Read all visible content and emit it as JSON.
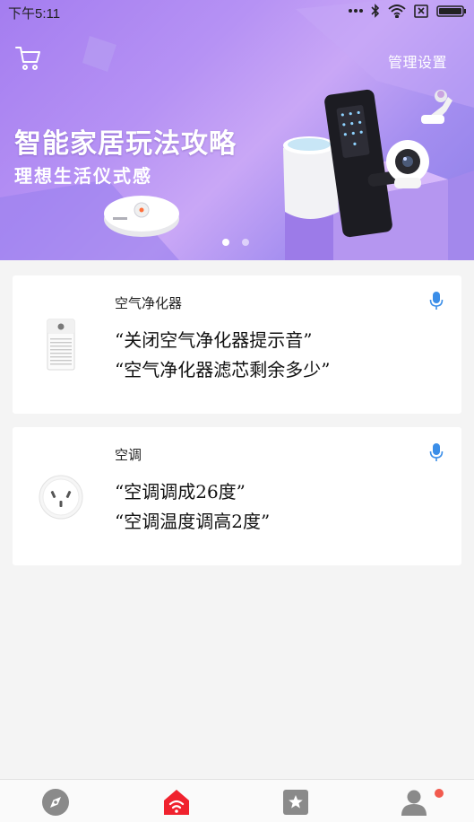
{
  "status_bar": {
    "time": "下午5:11",
    "icons": [
      "dots-icon",
      "bluetooth-icon",
      "wifi-icon",
      "no-sim-icon",
      "battery-icon"
    ]
  },
  "banner": {
    "cart_icon": "shopping-cart-icon",
    "manage_label": "管理设置",
    "title": "智能家居玩法攻略",
    "subtitle": "理想生活仪式感",
    "page_count": 2,
    "active_page": 0,
    "background_colors": [
      "#a47df0",
      "#c9a7f6",
      "#8c7ee8"
    ]
  },
  "cards": [
    {
      "device_name": "空气净化器",
      "device_icon": "air-purifier-icon",
      "mic_icon": "microphone-icon",
      "phrases": [
        "“关闭空气净化器提示音”",
        "“空气净化器滤芯剩余多少”"
      ]
    },
    {
      "device_name": "空调",
      "device_icon": "ac-socket-icon",
      "mic_icon": "microphone-icon",
      "phrases": [
        "“空调调成26度”",
        "“空调温度调高2度”"
      ]
    }
  ],
  "bottom_nav": {
    "items": [
      {
        "icon": "compass-icon",
        "active": false
      },
      {
        "icon": "home-icon",
        "active": true
      },
      {
        "icon": "star-box-icon",
        "active": false
      },
      {
        "icon": "profile-icon",
        "active": false,
        "badge": true
      }
    ],
    "active_color": "#f0222e",
    "inactive_color": "#8a8a8a",
    "badge_color": "#f25a4e"
  },
  "accent_colors": {
    "mic": "#3b8ee8"
  }
}
